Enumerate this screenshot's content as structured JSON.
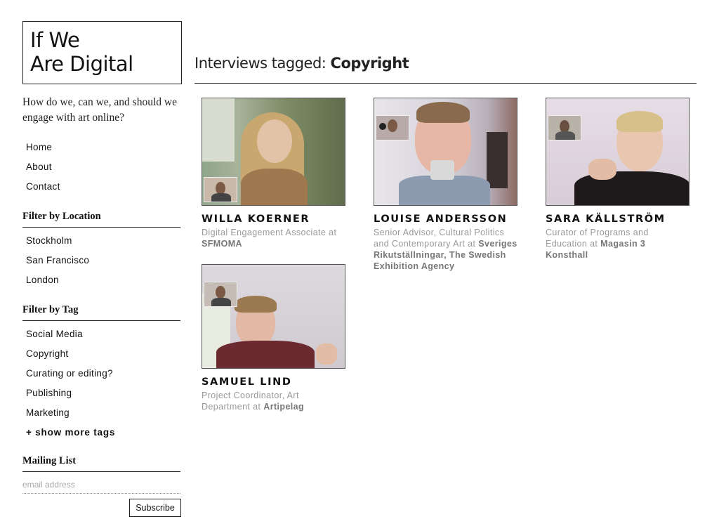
{
  "site": {
    "logo_line1": "If We",
    "logo_line2": "Are Digital",
    "tagline": "How do we, can we, and should we engage with art online?"
  },
  "nav": [
    "Home",
    "About",
    "Contact"
  ],
  "filter_location": {
    "title": "Filter by Location",
    "items": [
      "Stockholm",
      "San Francisco",
      "London"
    ]
  },
  "filter_tag": {
    "title": "Filter by Tag",
    "items": [
      "Social Media",
      "Copyright",
      "Curating or editing?",
      "Publishing",
      "Marketing"
    ],
    "more": "+ show more tags"
  },
  "mailing": {
    "title": "Mailing List",
    "placeholder": "email address",
    "button": "Subscribe"
  },
  "page": {
    "heading_prefix": "Interviews tagged:",
    "heading_tag": "Copyright"
  },
  "interviews": [
    {
      "name": "WILLA KOERNER",
      "role": "Digital Engagement Associate at",
      "org": "SFMOMA"
    },
    {
      "name": "LOUISE ANDERSSON",
      "role": "Senior Advisor, Cultural Politics and Contemporary Art at",
      "org": "Sveriges Rikutställningar, The Swedish Exhibition Agency"
    },
    {
      "name": "SARA KÄLLSTRÖM",
      "role": "Curator of Programs and Education at",
      "org": "Magasin 3 Konsthall"
    },
    {
      "name": "SAMUEL LIND",
      "role": "Project Coordinator, Art Department at",
      "org": "Artipelag"
    }
  ]
}
